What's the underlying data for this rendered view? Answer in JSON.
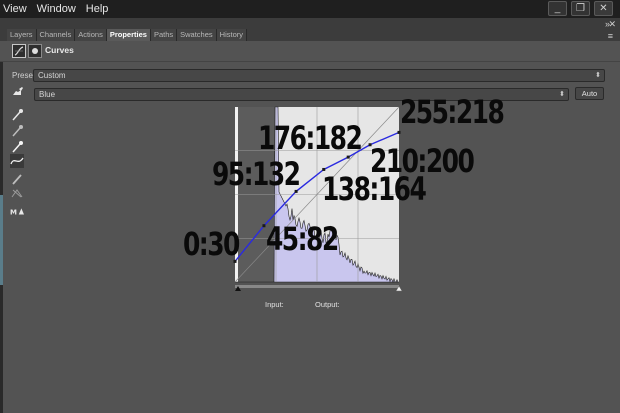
{
  "menu": [
    "View",
    "Window",
    "Help"
  ],
  "window_controls": [
    "_",
    "❐",
    "✕"
  ],
  "tabs": [
    "Layers",
    "Channels",
    "Actions",
    "Properties",
    "Paths",
    "Swatches",
    "History"
  ],
  "active_tab": "Properties",
  "panel": {
    "title": "Curves",
    "preset_label": "Preset:",
    "preset_value": "Custom",
    "channel_value": "Blue",
    "auto_label": "Auto",
    "input_label": "Input:",
    "output_label": "Output:"
  },
  "tools": [
    "target-adjust-tool",
    "sample-black-eyedropper",
    "sample-gray-eyedropper",
    "sample-white-eyedropper",
    "curve-edit-tool",
    "pencil-draw-tool",
    "smooth-curve-tool",
    "clipping-warning-tool"
  ],
  "curve_points": [
    {
      "label": "0:30",
      "input": 0,
      "output": 30
    },
    {
      "label": "45:82",
      "input": 45,
      "output": 82
    },
    {
      "label": "95:132",
      "input": 95,
      "output": 132
    },
    {
      "label": "138:164",
      "input": 138,
      "output": 164
    },
    {
      "label": "176:182",
      "input": 176,
      "output": 182
    },
    {
      "label": "210:200",
      "input": 210,
      "output": 200
    },
    {
      "label": "255:218",
      "input": 255,
      "output": 218
    }
  ],
  "colors": {
    "curve": "#2a2ae0",
    "histogram": "#c9c6ee",
    "annotation": "#0a0a0a"
  }
}
